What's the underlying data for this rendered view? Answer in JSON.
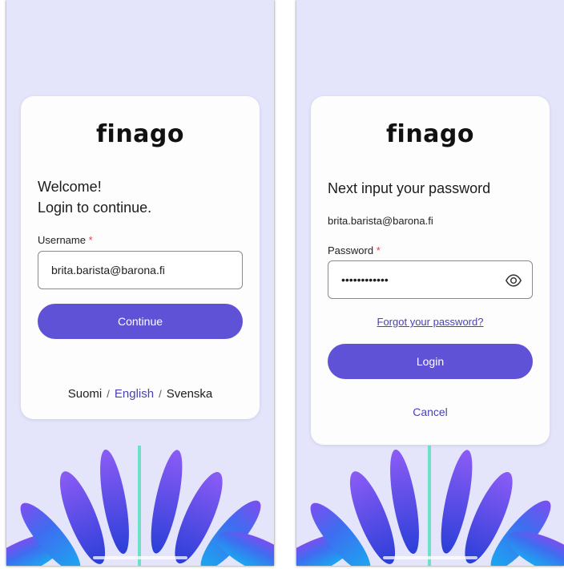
{
  "brand": {
    "logo_text": "finago",
    "primary_color": "#5f52d6",
    "link_color": "#4a3fb5",
    "background_color": "#e4e4fb"
  },
  "login_step": {
    "heading_line1": "Welcome!",
    "heading_line2": "Login to continue.",
    "username_label": "Username",
    "required_marker": "*",
    "username_value": "brita.barista@barona.fi",
    "continue_label": "Continue",
    "languages": [
      {
        "label": "Suomi",
        "active": false
      },
      {
        "label": "English",
        "active": true
      },
      {
        "label": "Svenska",
        "active": false
      }
    ],
    "language_separator": "/"
  },
  "password_step": {
    "heading": "Next input your password",
    "email": "brita.barista@barona.fi",
    "password_label": "Password",
    "required_marker": "*",
    "password_masked": "••••••••••••",
    "toggle_icon": "eye-icon",
    "forgot_label": "Forgot your password?",
    "login_label": "Login",
    "cancel_label": "Cancel"
  }
}
